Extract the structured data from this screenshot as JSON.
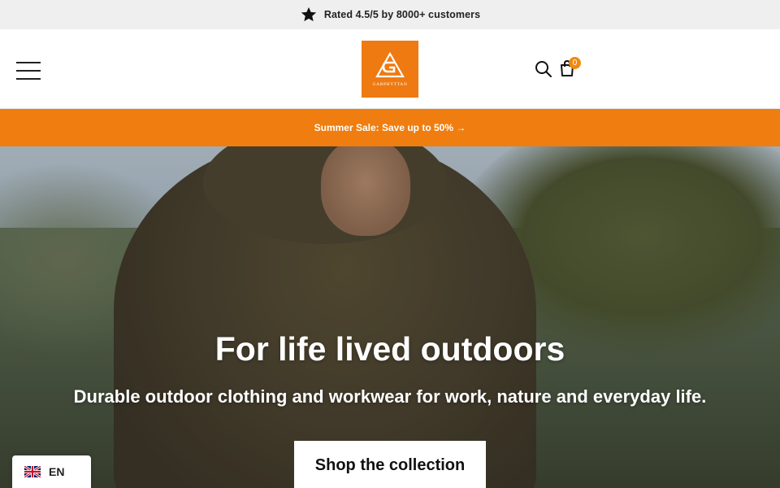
{
  "announcement": {
    "icon": "star-icon",
    "text": "Rated 4.5/5 by 8000+ customers"
  },
  "header": {
    "menu_icon": "hamburger-menu-icon",
    "logo_text": "GARPHYTTAN",
    "search_icon": "search-icon",
    "cart_icon": "shopping-bag-icon",
    "cart_count": "0"
  },
  "promo_bar": {
    "text": "Summer Sale: Save up to 50% →"
  },
  "hero": {
    "title": "For life lived outdoors",
    "subtitle": "Durable outdoor clothing and workwear for work, nature and everyday life.",
    "cta_label": "Shop the collection"
  },
  "language_switcher": {
    "flag_icon": "uk-flag-icon",
    "code": "EN"
  },
  "colors": {
    "brand_orange": "#ee7a11",
    "promo_orange": "#ef7d0f",
    "topbar_bg": "#efefef"
  }
}
